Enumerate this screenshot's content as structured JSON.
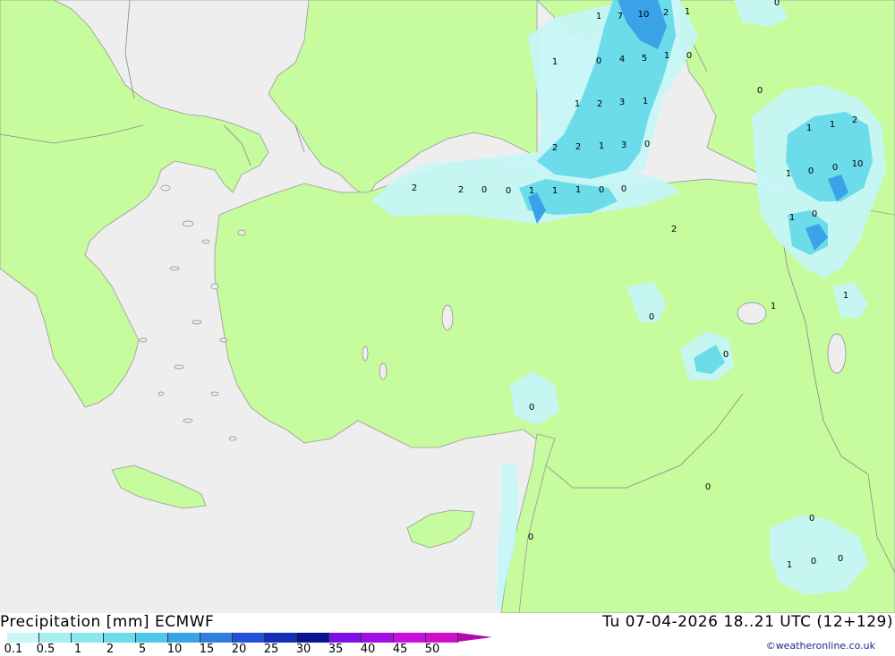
{
  "title": "Precipitation [mm] ECMWF",
  "timestamp": "Tu 07-04-2026 18..21 UTC (12+129)",
  "credit": "©weatheronline.co.uk",
  "colors": {
    "sea": "#eeeeee",
    "land": "#c6fb9e",
    "border": "#888888"
  },
  "legend": {
    "ticks": [
      "0.1",
      "0.5",
      "1",
      "2",
      "5",
      "10",
      "15",
      "20",
      "25",
      "30",
      "35",
      "40",
      "45",
      "50"
    ],
    "colors": [
      "#c6f6f6",
      "#a8f0f0",
      "#8be8ee",
      "#6cdcea",
      "#50c8ea",
      "#3aa2e6",
      "#2f7ee0",
      "#2350d8",
      "#1530b8",
      "#0a1490",
      "#7d10e6",
      "#a010e6",
      "#c810e0",
      "#d010c8",
      "#b00ab0"
    ]
  },
  "map_labels": [
    "1",
    "7",
    "10",
    "2",
    "1",
    "0",
    "1",
    "0",
    "4",
    "5",
    "1",
    "0",
    "0",
    "1",
    "2",
    "3",
    "1",
    "0",
    "2",
    "2",
    "1",
    "3",
    "2",
    "2",
    "0",
    "0",
    "1",
    "1",
    "1",
    "0",
    "0",
    "1",
    "1",
    "2",
    "1",
    "0",
    "0",
    "10",
    "1",
    "0",
    "2",
    "1",
    "0",
    "1",
    "0",
    "0",
    "0",
    "0",
    "0",
    "1",
    "0",
    "0"
  ]
}
